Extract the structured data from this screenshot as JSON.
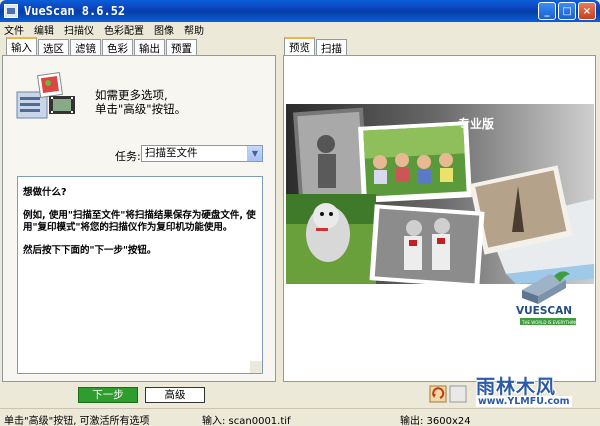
{
  "window": {
    "title": "VueScan 8.6.52",
    "buttons": [
      "_",
      "□",
      "×"
    ]
  },
  "menu": [
    "文件",
    "编辑",
    "扫描仪",
    "色彩配置",
    "图像",
    "帮助"
  ],
  "left_tabs": [
    "输入",
    "选区",
    "滤镜",
    "色彩",
    "输出",
    "预置"
  ],
  "left_active_tab": 0,
  "hint": {
    "line1": "如需更多选项,",
    "line2": "单击\"高级\"按钮。"
  },
  "task": {
    "label": "任务:",
    "value": "扫描至文件"
  },
  "help": {
    "p1": "想做什么?",
    "p2": "例如, 使用\"扫描至文件\"将扫描结果保存为硬盘文件, 使用\"复印模式\"将您的扫描仪作为复印机功能使用。",
    "p3": "然后按下下面的\"下一步\"按钮。"
  },
  "buttons": {
    "next": "下一步",
    "advanced": "高级"
  },
  "right_tabs": [
    "预览",
    "扫描"
  ],
  "right_active_tab": 0,
  "preview": {
    "edition": "专业版",
    "logo": "VUESCAN",
    "logo_tagline": "THE WORLD IS EVERYTHING"
  },
  "status": {
    "left": "单击\"高级\"按钮, 可激活所有选项",
    "mid": "输入: scan0001.tif",
    "right": "输出: 3600x24"
  },
  "watermark": {
    "title": "雨林木风",
    "url": "www.YLMFU.com"
  },
  "colors": {
    "titlebar": "#0a5fd8",
    "next_button": "#2e9d2e",
    "tab_highlight": "#f1b24a"
  }
}
